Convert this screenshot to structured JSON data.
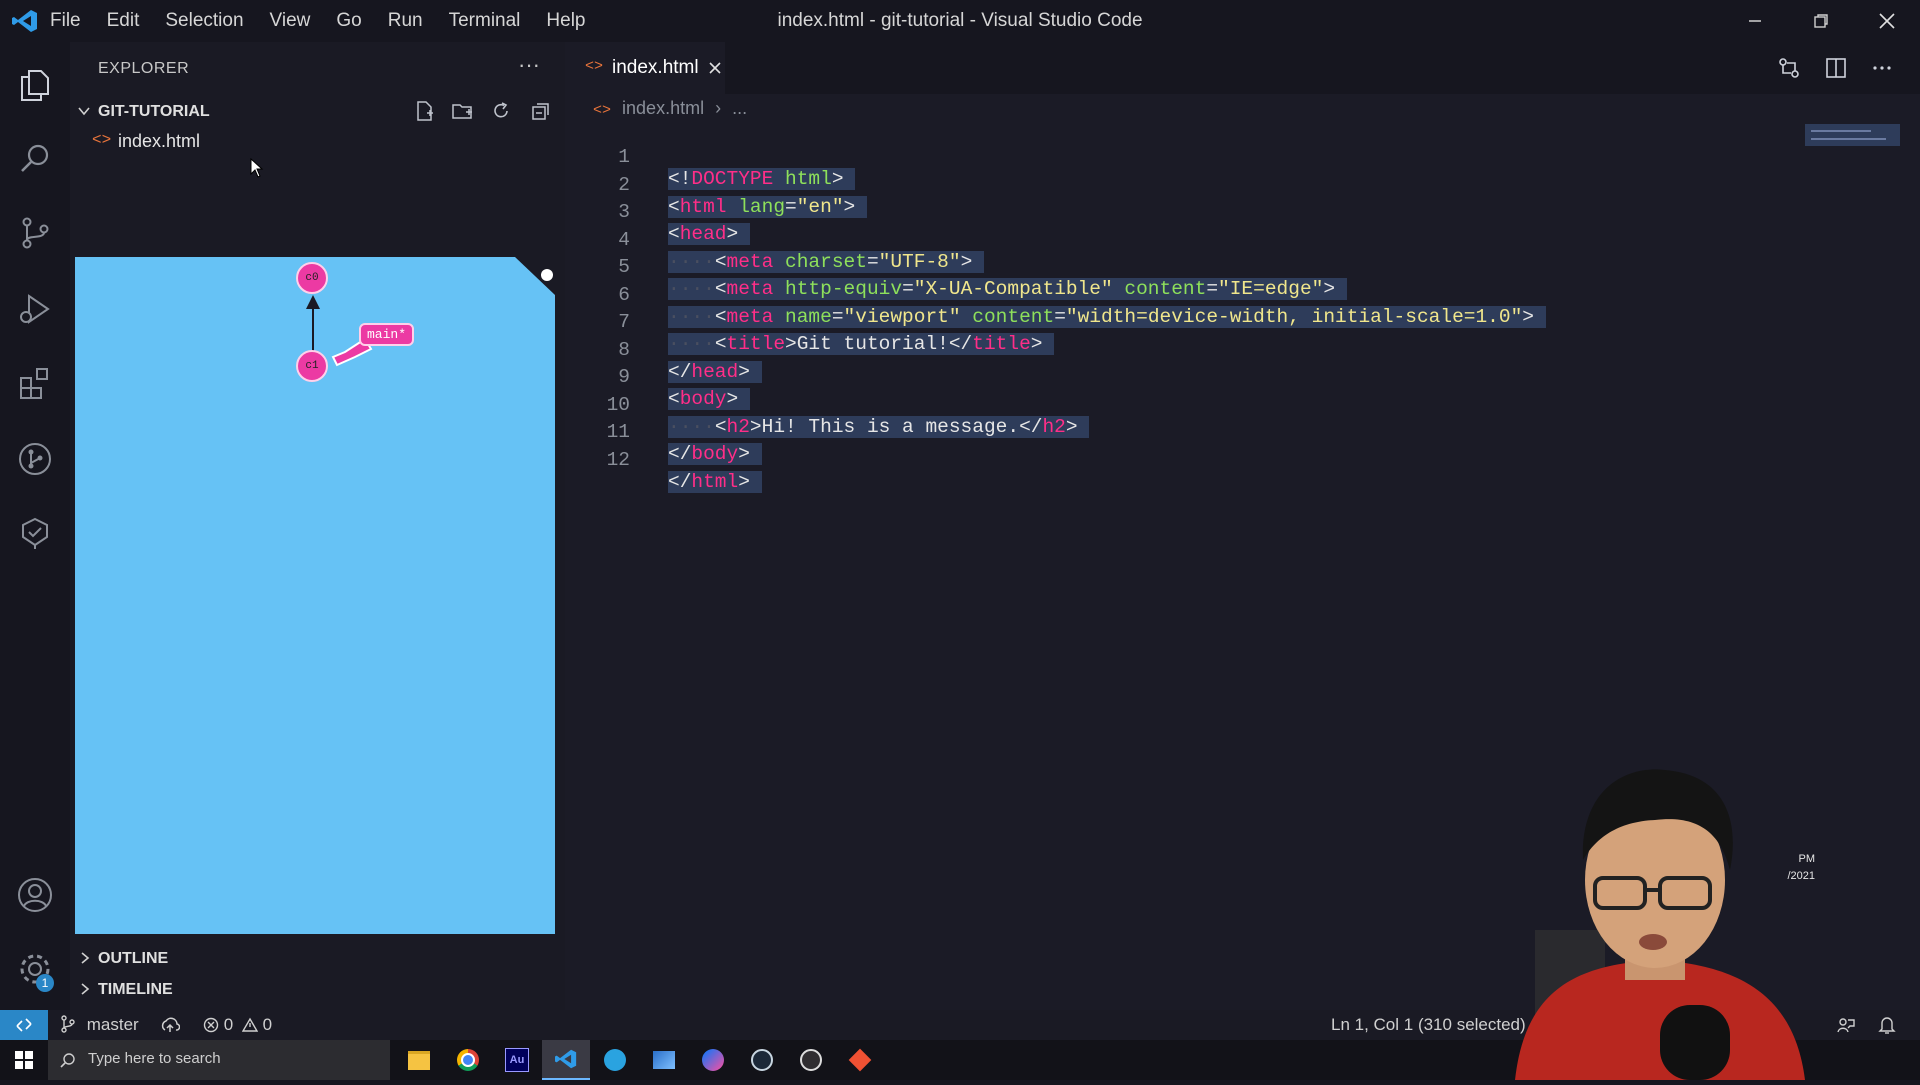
{
  "window": {
    "title": "index.html - git-tutorial - Visual Studio Code",
    "menu": [
      "File",
      "Edit",
      "Selection",
      "View",
      "Go",
      "Run",
      "Terminal",
      "Help"
    ]
  },
  "activity_bar": {
    "icons": [
      "files-icon",
      "search-icon",
      "source-control-icon",
      "run-debug-icon",
      "extensions-icon",
      "git-graph-icon",
      "testing-icon",
      "account-icon",
      "settings-icon"
    ],
    "settings_badge": "1"
  },
  "sidebar": {
    "title": "EXPLORER",
    "more": "···",
    "folder": "GIT-TUTORIAL",
    "files": [
      "index.html"
    ],
    "graph": {
      "commits": [
        "c0",
        "c1"
      ],
      "branch_label": "main*"
    },
    "sections": [
      "OUTLINE",
      "TIMELINE"
    ]
  },
  "editor": {
    "tab_label": "index.html",
    "breadcrumb_file": "index.html",
    "breadcrumb_rest": "...",
    "line_numbers": [
      "1",
      "2",
      "3",
      "4",
      "5",
      "6",
      "7",
      "8",
      "9",
      "10",
      "11",
      "12"
    ],
    "code": {
      "l1": [
        "<!",
        "DOCTYPE",
        " html",
        ">"
      ],
      "l2": [
        "<",
        "html",
        " lang",
        "=",
        "\"en\"",
        ">"
      ],
      "l3": [
        "<",
        "head",
        ">"
      ],
      "l4": [
        "<",
        "meta",
        " charset",
        "=",
        "\"UTF-8\"",
        ">"
      ],
      "l5": [
        "<",
        "meta",
        " http-equiv",
        "=",
        "\"X-UA-Compatible\"",
        " content",
        "=",
        "\"IE=edge\"",
        ">"
      ],
      "l6": [
        "<",
        "meta",
        " name",
        "=",
        "\"viewport\"",
        " content",
        "=",
        "\"width=device-width, initial-scale=1.0\"",
        ">"
      ],
      "l7": [
        "<",
        "title",
        ">",
        "Git tutorial!",
        "</",
        "title",
        ">"
      ],
      "l8": [
        "</",
        "head",
        ">"
      ],
      "l9": [
        "<",
        "body",
        ">"
      ],
      "l10": [
        "<",
        "h2",
        ">",
        "Hi! This is a message.",
        "</",
        "h2",
        ">"
      ],
      "l11": [
        "</",
        "body",
        ">"
      ],
      "l12": [
        "</",
        "html",
        ">"
      ]
    }
  },
  "status_bar": {
    "branch": "master",
    "errors": "0",
    "warnings": "0",
    "cursor": "Ln 1, Col 1 (310 selected)"
  },
  "taskbar": {
    "search_placeholder": "Type here to search",
    "clock_time": "PM",
    "clock_date": "/2021"
  },
  "colors": {
    "accent": "#2a87c7",
    "tag": "#ff2e88",
    "attr": "#8ee05b",
    "string": "#f0e68c",
    "graph_bg": "#66c2f5",
    "commit": "#ec3aa3"
  }
}
